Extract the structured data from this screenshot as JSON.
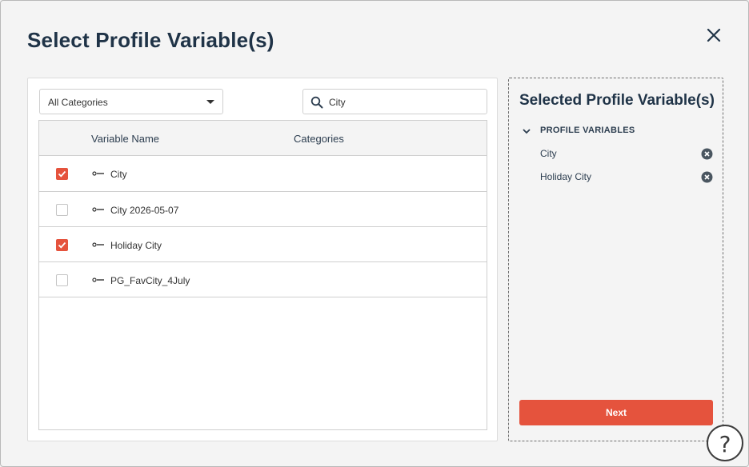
{
  "dialog": {
    "title": "Select Profile Variable(s)"
  },
  "filters": {
    "category_value": "All Categories",
    "search_value": "City"
  },
  "table": {
    "columns": [
      "Variable Name",
      "Categories"
    ],
    "rows": [
      {
        "name": "City",
        "category": "",
        "checked": true
      },
      {
        "name": "City 2026-05-07",
        "category": "",
        "checked": false
      },
      {
        "name": "Holiday City",
        "category": "",
        "checked": true
      },
      {
        "name": "PG_FavCity_4July",
        "category": "",
        "checked": false
      }
    ]
  },
  "selected_panel": {
    "title": "Selected Profile Variable(s)",
    "group_label": "PROFILE VARIABLES",
    "items": [
      "City",
      "Holiday City"
    ],
    "next_label": "Next"
  },
  "help": {
    "glyph": "?"
  },
  "colors": {
    "accent": "#e5533d",
    "title": "#1f3347"
  },
  "icons": {
    "close": "close-icon",
    "search": "search-icon",
    "dropdown": "chevron-down-icon",
    "variable": "variable-key-icon",
    "remove": "remove-circle-icon",
    "help": "help-icon"
  }
}
